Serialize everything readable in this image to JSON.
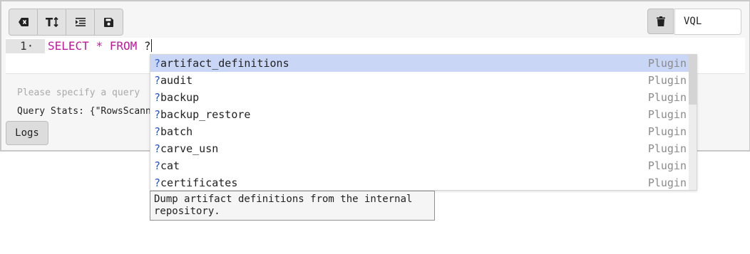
{
  "toolbar": {
    "buttons": [
      {
        "icon": "clear-icon"
      },
      {
        "icon": "text-size-icon"
      },
      {
        "icon": "indent-icon"
      },
      {
        "icon": "save-icon"
      }
    ]
  },
  "language": "VQL",
  "editor": {
    "line_number": "1",
    "fold_marker": "·",
    "keyword_select": "SELECT",
    "star": "*",
    "keyword_from": "FROM",
    "typed": "?"
  },
  "output": {
    "hint": "Please specify a query",
    "stats": "Query Stats: {\"RowsScanned\""
  },
  "logs_label": "Logs",
  "autocomplete": {
    "prefix": "?",
    "items": [
      {
        "name": "artifact_definitions",
        "type": "Plugin"
      },
      {
        "name": "audit",
        "type": "Plugin"
      },
      {
        "name": "backup",
        "type": "Plugin"
      },
      {
        "name": "backup_restore",
        "type": "Plugin"
      },
      {
        "name": "batch",
        "type": "Plugin"
      },
      {
        "name": "carve_usn",
        "type": "Plugin"
      },
      {
        "name": "cat",
        "type": "Plugin"
      },
      {
        "name": "certificates",
        "type": "Plugin"
      }
    ],
    "selected_index": 0,
    "doc": "Dump artifact definitions from the internal repository."
  },
  "colors": {
    "keyword": "#c0189b",
    "selection": "#cad6f6",
    "prefix": "#2a56c6"
  }
}
